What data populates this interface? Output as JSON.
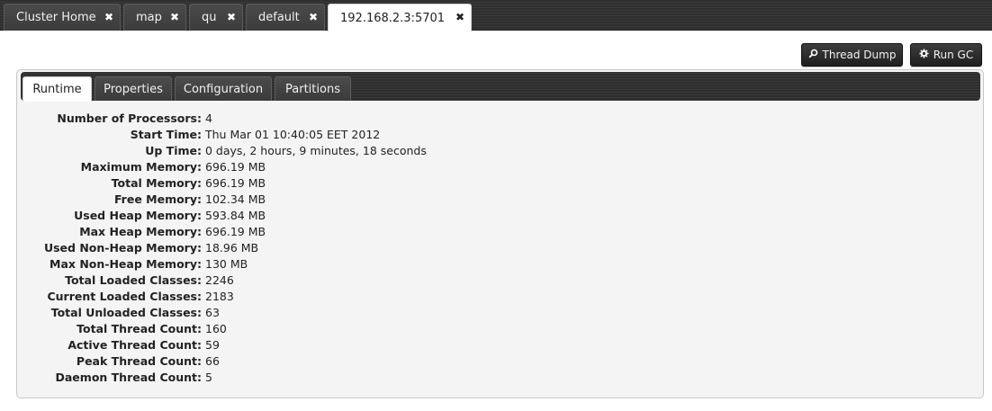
{
  "tabs": [
    {
      "label": "Cluster Home",
      "close": "✖"
    },
    {
      "label": "map",
      "close": "✖"
    },
    {
      "label": "qu",
      "close": "✖"
    },
    {
      "label": "default",
      "close": "✖"
    },
    {
      "label": "192.168.2.3:5701",
      "close": "✖",
      "active": true
    }
  ],
  "actions": {
    "thread_dump": {
      "icon": "search-icon",
      "label": "Thread Dump"
    },
    "run_gc": {
      "icon": "gear-icon",
      "label": "Run GC"
    }
  },
  "subtabs": [
    {
      "label": "Runtime",
      "active": true
    },
    {
      "label": "Properties"
    },
    {
      "label": "Configuration"
    },
    {
      "label": "Partitions"
    }
  ],
  "runtime": [
    {
      "label": "Number of Processors:",
      "value": "4"
    },
    {
      "label": "Start Time:",
      "value": "Thu Mar 01 10:40:05 EET 2012"
    },
    {
      "label": "Up Time:",
      "value": "0 days, 2 hours, 9 minutes, 18 seconds"
    },
    {
      "label": "Maximum Memory:",
      "value": "696.19 MB"
    },
    {
      "label": "Total Memory:",
      "value": "696.19 MB"
    },
    {
      "label": "Free Memory:",
      "value": "102.34 MB"
    },
    {
      "label": "Used Heap Memory:",
      "value": "593.84 MB"
    },
    {
      "label": "Max Heap Memory:",
      "value": "696.19 MB"
    },
    {
      "label": "Used Non-Heap Memory:",
      "value": "18.96 MB"
    },
    {
      "label": "Max Non-Heap Memory:",
      "value": "130 MB"
    },
    {
      "label": "Total Loaded Classes:",
      "value": "2246"
    },
    {
      "label": "Current Loaded Classes:",
      "value": "2183"
    },
    {
      "label": "Total Unloaded Classes:",
      "value": "63"
    },
    {
      "label": "Total Thread Count:",
      "value": "160"
    },
    {
      "label": "Active Thread Count:",
      "value": "59"
    },
    {
      "label": "Peak Thread Count:",
      "value": "66"
    },
    {
      "label": "Daemon Thread Count:",
      "value": "5"
    }
  ]
}
